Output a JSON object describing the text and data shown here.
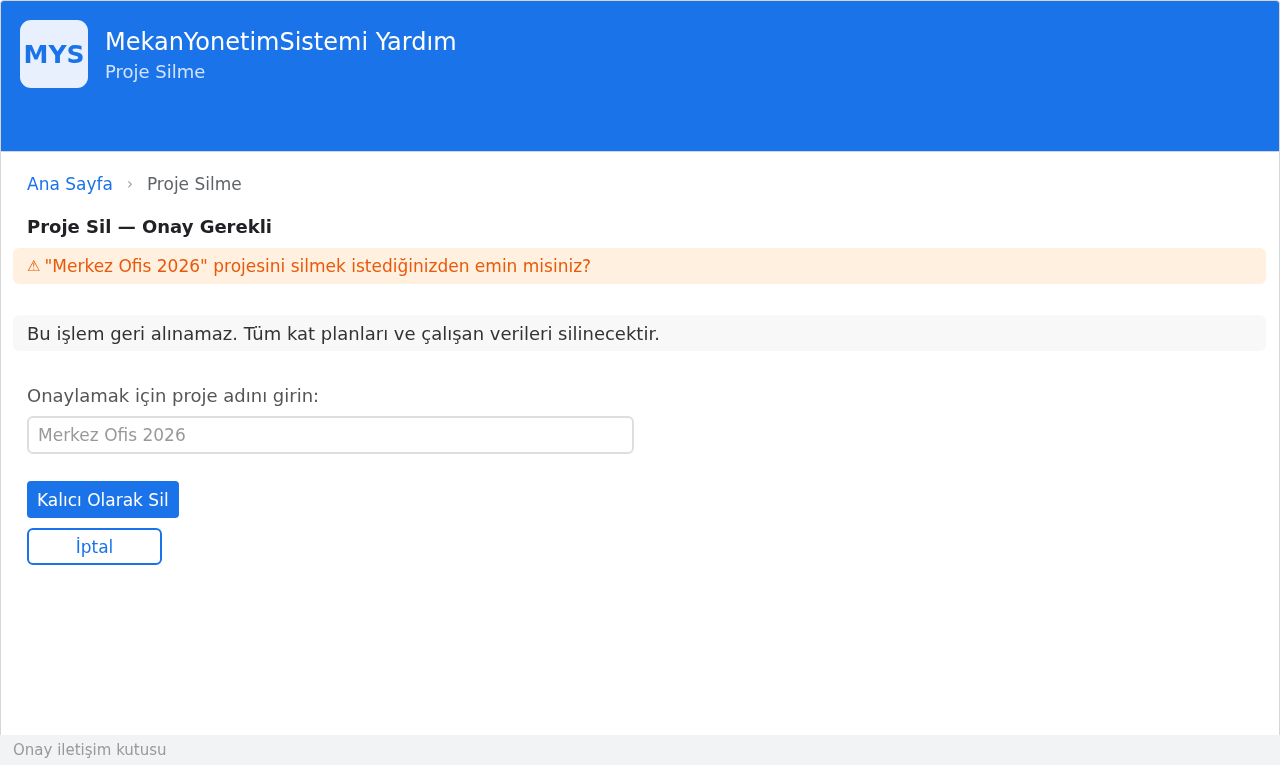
{
  "header": {
    "logo": "MYS",
    "title": "MekanYonetimSistemi Yardım",
    "subtitle": "Proje Silme"
  },
  "breadcrumb": [
    {
      "label": "Ana Sayfa",
      "kind": "link"
    },
    {
      "label": "Proje Silme",
      "kind": "current"
    }
  ],
  "breadcrumb_separator": "›",
  "heading": "Proje Sil — Onay Gerekli",
  "warning": {
    "icon": "⚠",
    "text": "\"Merkez Ofis 2026\" projesini silmek istediğinizden emin misiniz?"
  },
  "notice": "Bu işlem geri alınamaz. Tüm kat planları ve çalışan verileri silinecektir.",
  "confirm_field": {
    "label": "Onaylamak için proje adını girin:",
    "placeholder": "Merkez Ofis 2026"
  },
  "buttons": [
    {
      "label": "Kalıcı Olarak Sil",
      "kind": "primary"
    },
    {
      "label": "İptal",
      "kind": "outline"
    }
  ],
  "status_bar": "Onay iletişim kutusu"
}
